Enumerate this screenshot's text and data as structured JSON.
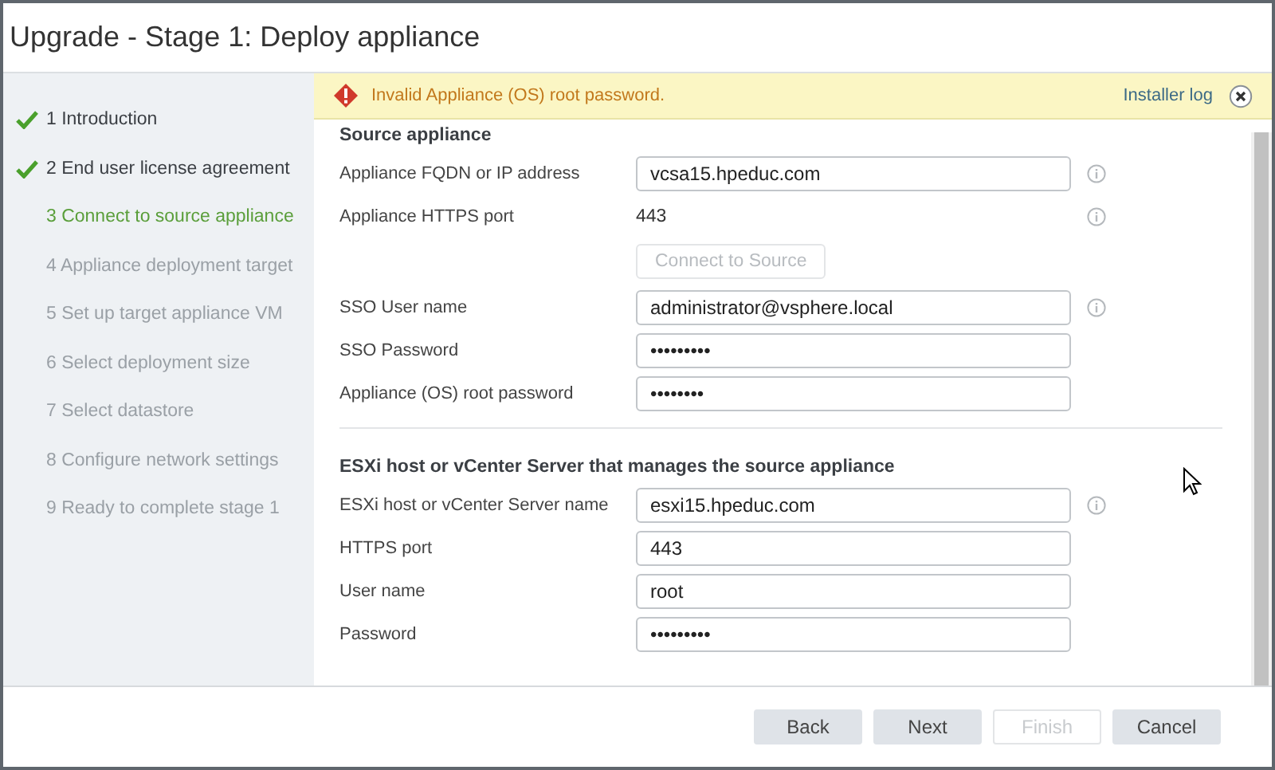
{
  "window": {
    "title": "Upgrade - Stage 1: Deploy appliance"
  },
  "steps": [
    {
      "label": "1 Introduction",
      "checked": true,
      "selected": false
    },
    {
      "label": "2 End user license agreement",
      "checked": true,
      "selected": false
    },
    {
      "label": "3 Connect to source appliance",
      "checked": false,
      "selected": true
    },
    {
      "label": "4 Appliance deployment target",
      "checked": false,
      "selected": false
    },
    {
      "label": "5 Set up target appliance VM",
      "checked": false,
      "selected": false
    },
    {
      "label": "6 Select deployment size",
      "checked": false,
      "selected": false
    },
    {
      "label": "7 Select datastore",
      "checked": false,
      "selected": false
    },
    {
      "label": "8 Configure network settings",
      "checked": false,
      "selected": false
    },
    {
      "label": "9 Ready to complete stage 1",
      "checked": false,
      "selected": false
    }
  ],
  "alert": {
    "message": "Invalid Appliance (OS) root password.",
    "link": "Installer log"
  },
  "sections": [
    {
      "heading": "Source appliance",
      "rows": [
        {
          "kind": "input",
          "label": "Appliance FQDN or IP address",
          "value": "vcsa15.hpeduc.com",
          "info": true
        },
        {
          "kind": "text",
          "label": "Appliance HTTPS port",
          "value": "443",
          "info": true
        },
        {
          "kind": "button",
          "value": "Connect to Source",
          "disabled": true
        },
        {
          "kind": "input",
          "label": "SSO User name",
          "value": "administrator@vsphere.local",
          "info": true
        },
        {
          "kind": "input",
          "label": "SSO Password",
          "value": "•••••••••",
          "info": false
        },
        {
          "kind": "input",
          "label": "Appliance (OS) root password",
          "value": "••••••••",
          "info": false
        }
      ]
    },
    {
      "heading": "ESXi host or vCenter Server that manages the source appliance",
      "rows": [
        {
          "kind": "input",
          "label": "ESXi host or vCenter Server name",
          "value": "esxi15.hpeduc.com",
          "info": true
        },
        {
          "kind": "input",
          "label": "HTTPS port",
          "value": "443",
          "info": false
        },
        {
          "kind": "input",
          "label": "User name",
          "value": "root",
          "info": false
        },
        {
          "kind": "input",
          "label": "Password",
          "value": "•••••••••",
          "info": false
        }
      ]
    }
  ],
  "buttons": [
    {
      "label": "Back",
      "disabled": false
    },
    {
      "label": "Next",
      "disabled": false
    },
    {
      "label": "Finish",
      "disabled": true
    },
    {
      "label": "Cancel",
      "disabled": false
    }
  ]
}
